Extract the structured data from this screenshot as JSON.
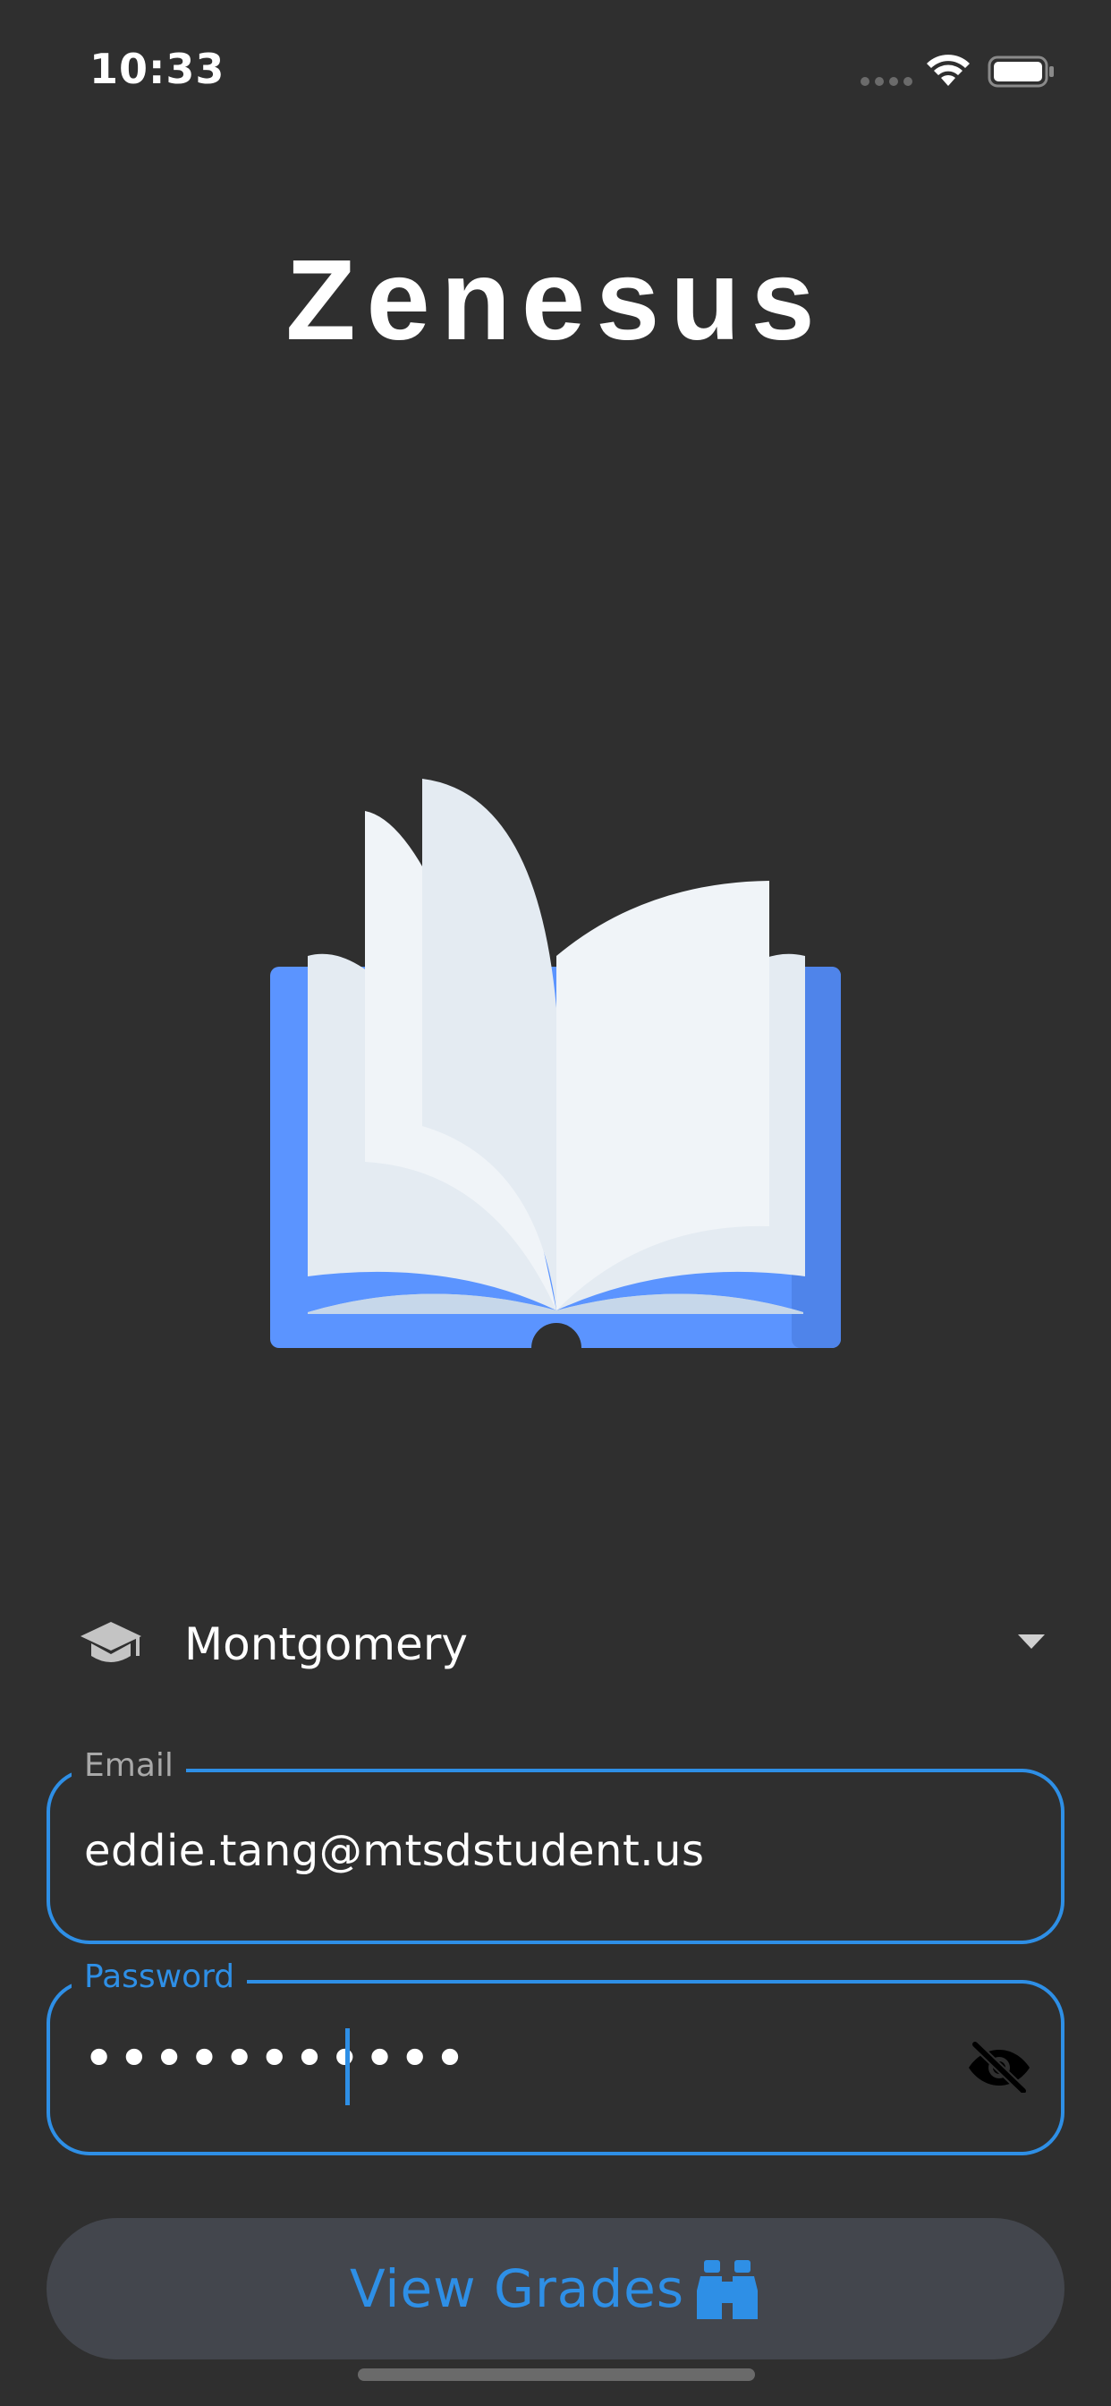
{
  "status_bar": {
    "time": "10:33"
  },
  "app": {
    "title": "Zenesus"
  },
  "school_picker": {
    "selected": "Montgomery",
    "icon": "graduation-cap-icon"
  },
  "email_field": {
    "label": "Email",
    "value": "eddie.tang@mtsdstudent.us"
  },
  "password_field": {
    "label": "Password",
    "masked_value": "•••••••••••",
    "toggle_icon": "eye-off-icon"
  },
  "submit": {
    "label": "View Grades",
    "icon": "binoculars-icon"
  },
  "colors": {
    "background": "#2f2f2f",
    "accent": "#2e8fe6",
    "button_background": "#43464d",
    "book_cover": "#5b94ff"
  }
}
